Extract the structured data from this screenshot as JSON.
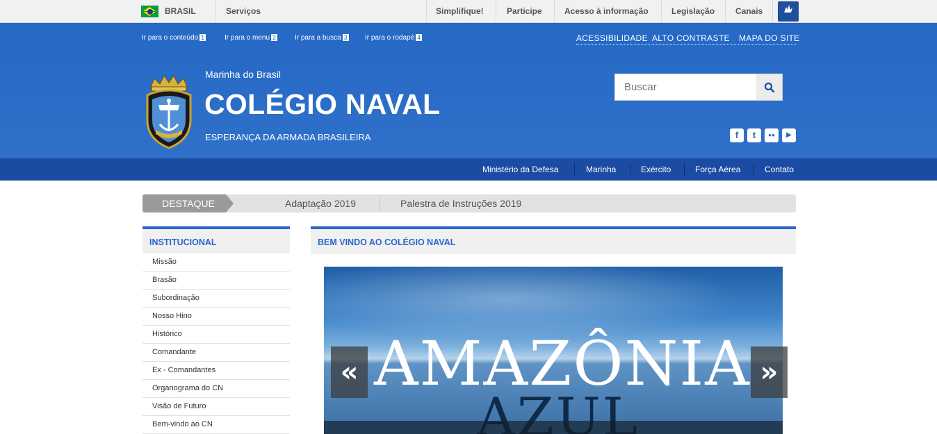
{
  "gov_bar": {
    "country": "BRASIL",
    "services": "Serviços",
    "links": [
      "Simplifique!",
      "Participe",
      "Acesso à informação",
      "Legislação",
      "Canais"
    ]
  },
  "skip_links": [
    {
      "label": "Ir para o conteúdo",
      "key": "1"
    },
    {
      "label": "Ir para o menu",
      "key": "2"
    },
    {
      "label": "Ir para a busca",
      "key": "3"
    },
    {
      "label": "Ir para o rodapé",
      "key": "4"
    }
  ],
  "accessibility": [
    "ACESSIBILIDADE",
    "ALTO CONTRASTE",
    "MAPA DO SITE"
  ],
  "header": {
    "kicker": "Marinha do Brasil",
    "title": "COLÉGIO NAVAL",
    "slogan": "ESPERANÇA DA ARMADA BRASILEIRA"
  },
  "search": {
    "placeholder": "Buscar"
  },
  "social": [
    {
      "name": "facebook-icon",
      "glyph": "f"
    },
    {
      "name": "twitter-icon",
      "glyph": "t"
    },
    {
      "name": "flickr-icon",
      "glyph": "●●"
    },
    {
      "name": "youtube-icon",
      "glyph": "▶"
    }
  ],
  "subnav": [
    "Ministério da Defesa",
    "Marinha",
    "Exército",
    "Força Aérea",
    "Contato"
  ],
  "destaque": {
    "label": "DESTAQUE",
    "items": [
      "Adaptação 2019",
      "Palestra de Instruções 2019"
    ]
  },
  "sidebar": {
    "title": "INSTITUCIONAL",
    "items": [
      "Missão",
      "Brasão",
      "Subordinação",
      "Nosso Hino",
      "Histórico",
      "Comandante",
      "Ex - Comandantes",
      "Organograma do CN",
      "Visão de Futuro",
      "Bem-vindo ao CN"
    ]
  },
  "main": {
    "title": "BEM VINDO AO COLÉGIO NAVAL",
    "banner_line1": "AMAZÔNIA",
    "banner_line2": "AZUL",
    "prev": "«",
    "next": "»"
  },
  "colors": {
    "brand_blue": "#2568c6",
    "nav_blue": "#1c4ba3",
    "accent": "#2b66cc"
  }
}
